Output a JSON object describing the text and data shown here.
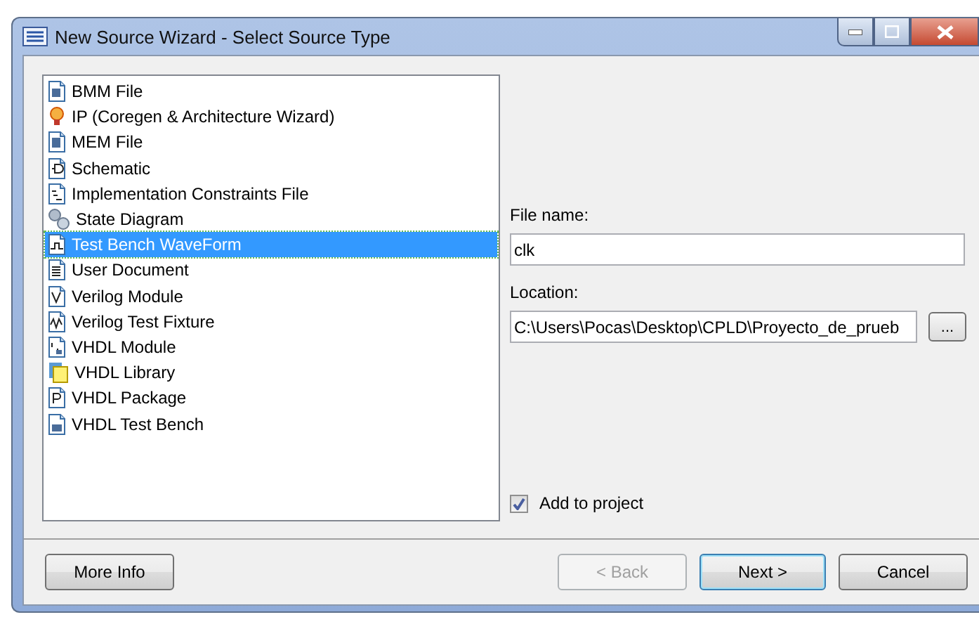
{
  "window": {
    "title": "New Source Wizard - Select Source Type"
  },
  "source_types": [
    {
      "label": "BMM File",
      "selected": false
    },
    {
      "label": "IP (Coregen & Architecture Wizard)",
      "selected": false
    },
    {
      "label": "MEM File",
      "selected": false
    },
    {
      "label": "Schematic",
      "selected": false
    },
    {
      "label": "Implementation Constraints File",
      "selected": false
    },
    {
      "label": "State Diagram",
      "selected": false
    },
    {
      "label": "Test Bench WaveForm",
      "selected": true
    },
    {
      "label": "User Document",
      "selected": false
    },
    {
      "label": "Verilog Module",
      "selected": false
    },
    {
      "label": "Verilog Test Fixture",
      "selected": false
    },
    {
      "label": "VHDL Module",
      "selected": false
    },
    {
      "label": "VHDL Library",
      "selected": false
    },
    {
      "label": "VHDL Package",
      "selected": false
    },
    {
      "label": "VHDL Test Bench",
      "selected": false
    }
  ],
  "file_name": {
    "label": "File name:",
    "value": "clk"
  },
  "location": {
    "label": "Location:",
    "value": "C:\\Users\\Pocas\\Desktop\\CPLD\\Proyecto_de_prueb",
    "browse": "..."
  },
  "add_to_project": {
    "label": "Add to project",
    "checked": true
  },
  "buttons": {
    "more_info": {
      "label": "More Info"
    },
    "back": {
      "label": "< Back",
      "disabled": true
    },
    "next": {
      "label": "Next >",
      "disabled": false
    },
    "cancel": {
      "label": "Cancel",
      "disabled": false
    }
  }
}
